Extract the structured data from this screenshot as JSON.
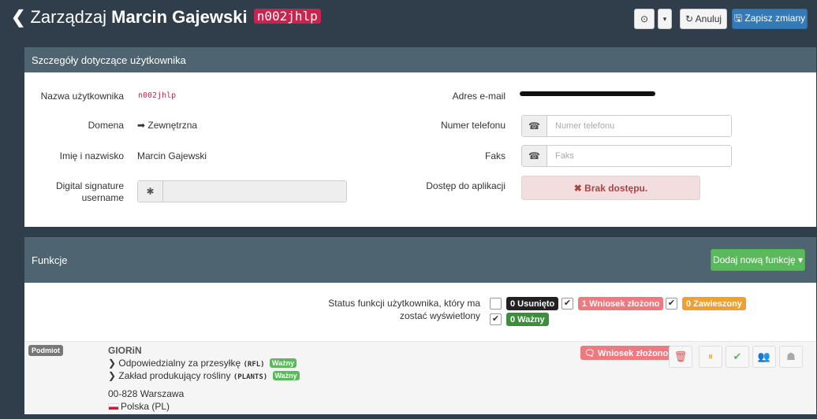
{
  "header": {
    "back_icon": "❮",
    "title_prefix": "Zarządzaj",
    "user_name": "Marcin Gajewski",
    "user_code": "n002jhlp",
    "history_icon": "⊙",
    "caret": "▾",
    "cancel_label": "↻ Anuluj",
    "save_label": "🖫 Zapisz zmiany"
  },
  "details": {
    "heading": "Szczegóły dotyczące użytkownika",
    "username_label": "Nazwa użytkownika",
    "username_value": "n002jhlp",
    "domain_label": "Domena",
    "domain_value": "➡ Zewnętrzna",
    "fullname_label": "Imię i nazwisko",
    "fullname_value": "Marcin Gajewski",
    "signature_label": "Digital signature username",
    "signature_icon": "✱",
    "email_label": "Adres e-mail",
    "phone_label": "Numer telefonu",
    "phone_icon": "☎",
    "phone_placeholder": "Numer telefonu",
    "fax_label": "Faks",
    "fax_icon": "☎",
    "fax_placeholder": "Faks",
    "access_label": "Dostęp do aplikacji",
    "access_value": "✖ Brak dostępu."
  },
  "functions": {
    "heading": "Funkcje",
    "add_label": "Dodaj nową funkcję ▾",
    "status_prompt": "Status funkcji użytkownika, który ma zostać wyświetlony",
    "filters": [
      {
        "checked": false,
        "label": "0 Usunięto",
        "color": "#222222"
      },
      {
        "checked": true,
        "label": "1 Wniosek złożono",
        "color": "#f0787f"
      },
      {
        "checked": true,
        "label": "0 Zawieszony",
        "color": "#f0a030"
      },
      {
        "checked": true,
        "label": "0 Ważny",
        "color": "#3c8d3c"
      }
    ],
    "row": {
      "type_badge": "Podmiot",
      "entity_name": "GIORiN",
      "role1": "❯ Odpowiedzialny za przesyłkę",
      "role1_code": "(RFL)",
      "role1_status": "Ważny",
      "role2": "❯ Zakład produkujący rośliny",
      "role2_code": "(PLANTS)",
      "role2_status": "Ważny",
      "address_line": "00-828 Warszawa",
      "country": "Polska (PL)",
      "status_badge": "🗨 Wniosek złożono",
      "actions": [
        "🗑",
        "⏸",
        "✔",
        "👥",
        "☗"
      ]
    }
  }
}
